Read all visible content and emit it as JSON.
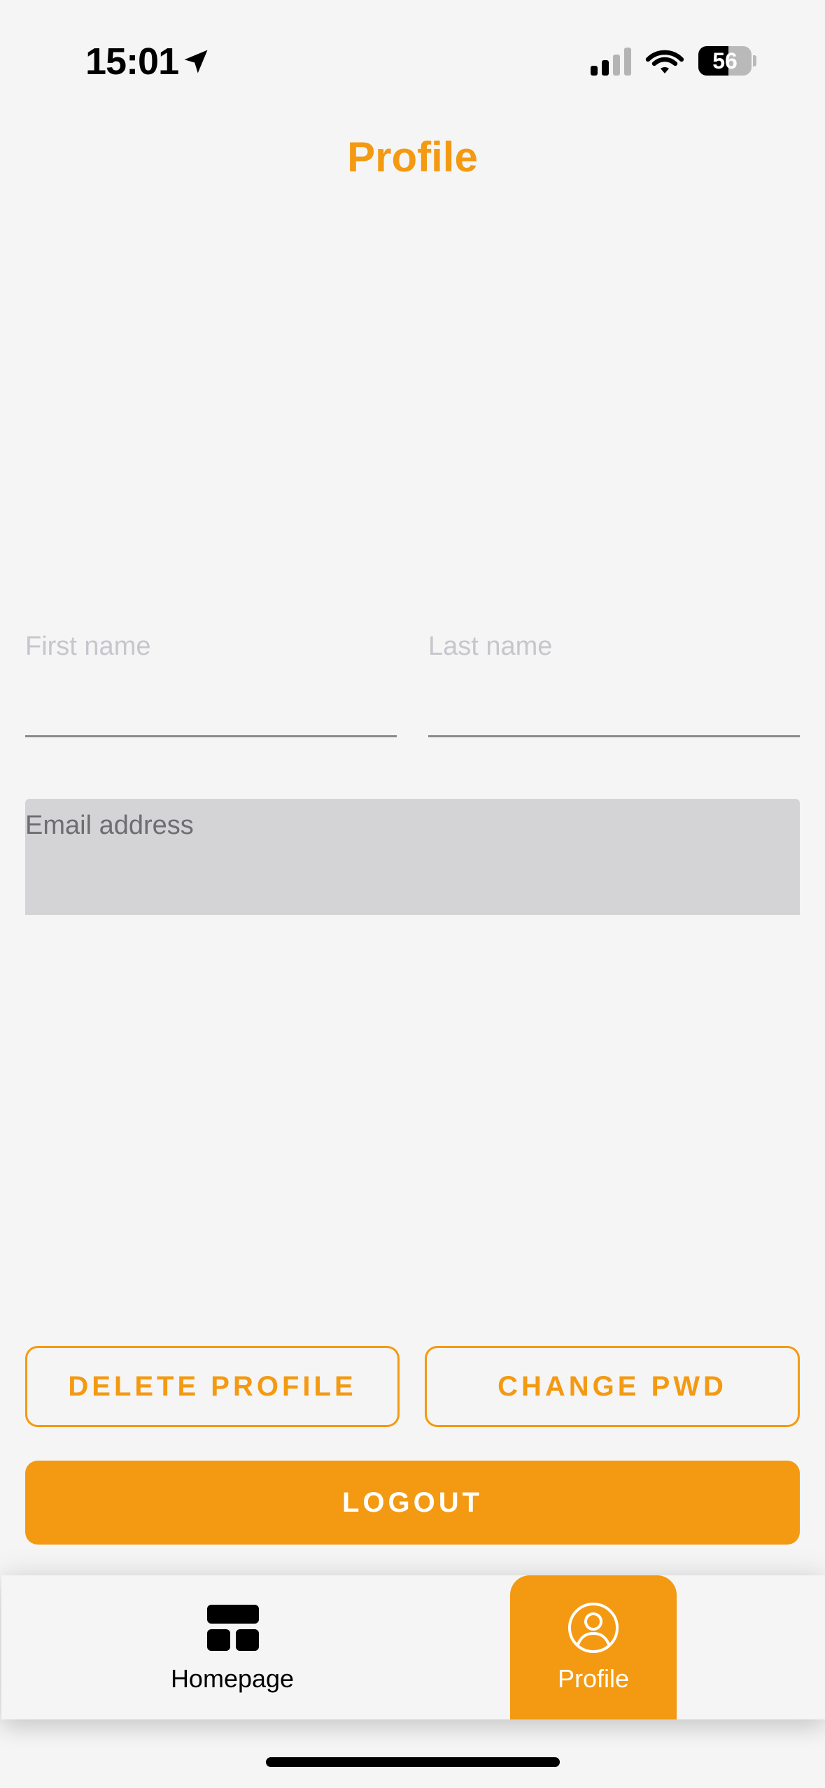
{
  "status_bar": {
    "time": "15:01",
    "battery_level": "56",
    "battery_fraction": 0.56,
    "icons": [
      "location-arrow-icon",
      "cellular-signal-icon",
      "wifi-icon",
      "battery-icon"
    ]
  },
  "header": {
    "title": "Profile"
  },
  "form": {
    "first_name": {
      "placeholder": "First name",
      "value": ""
    },
    "last_name": {
      "placeholder": "Last name",
      "value": ""
    },
    "email": {
      "label": "Email address",
      "value": ""
    }
  },
  "actions": {
    "delete_label": "DELETE PROFILE",
    "change_pwd_label": "CHANGE PWD",
    "logout_label": "LOGOUT"
  },
  "tab_bar": {
    "tabs": [
      {
        "label": "Homepage",
        "icon": "dashboard-icon",
        "active": false
      },
      {
        "label": "Profile",
        "icon": "user-circle-icon",
        "active": true
      }
    ]
  },
  "colors": {
    "accent": "#f39a12",
    "background": "#f5f5f5",
    "disabled_field": "#d4d4d6",
    "placeholder": "#c6c6cc"
  }
}
